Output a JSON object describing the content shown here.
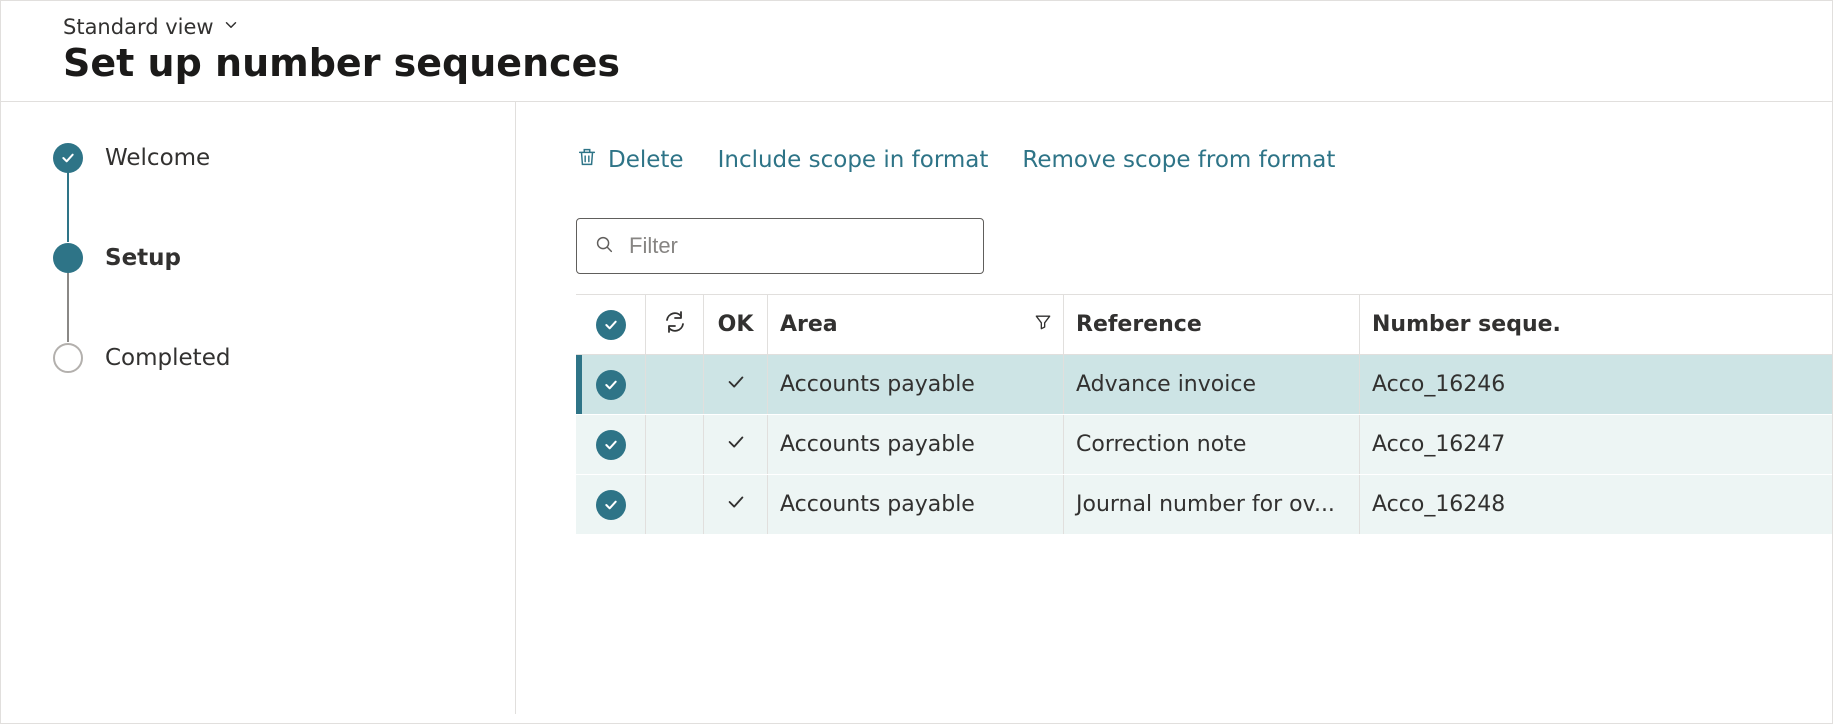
{
  "header": {
    "view_label": "Standard view",
    "page_title": "Set up number sequences"
  },
  "wizard": {
    "steps": [
      {
        "label": "Welcome",
        "status": "done"
      },
      {
        "label": "Setup",
        "status": "current"
      },
      {
        "label": "Completed",
        "status": "pending"
      }
    ]
  },
  "toolbar": {
    "delete_label": "Delete",
    "include_scope_label": "Include scope in format",
    "remove_scope_label": "Remove scope from format"
  },
  "filter": {
    "placeholder": "Filter",
    "value": ""
  },
  "grid": {
    "columns": {
      "ok": "OK",
      "area": "Area",
      "reference": "Reference",
      "sequence": "Number seque..."
    },
    "rows": [
      {
        "selected": true,
        "ok": true,
        "area": "Accounts payable",
        "reference": "Advance invoice",
        "sequence": "Acco_16246",
        "row_selected": true
      },
      {
        "selected": true,
        "ok": true,
        "area": "Accounts payable",
        "reference": "Correction note",
        "sequence": "Acco_16247",
        "row_selected": false
      },
      {
        "selected": true,
        "ok": true,
        "area": "Accounts payable",
        "reference": "Journal number for ov...",
        "sequence": "Acco_16248",
        "row_selected": false
      }
    ]
  }
}
